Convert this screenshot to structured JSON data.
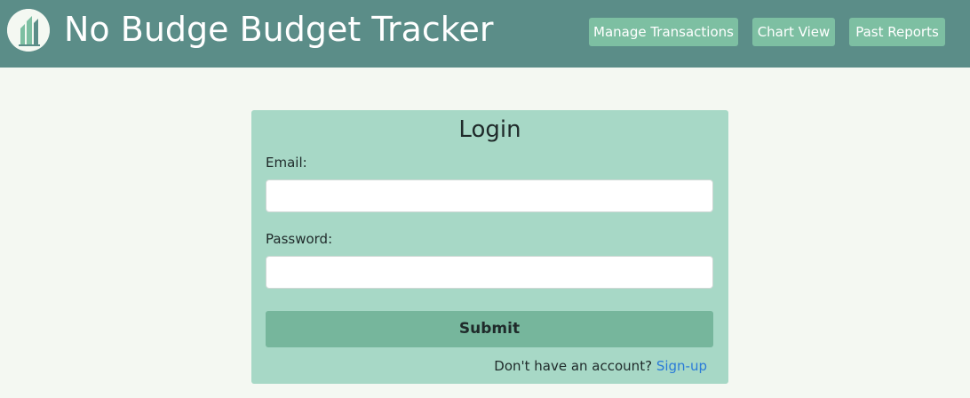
{
  "header": {
    "title": "No Budge Budget Tracker",
    "nav": [
      {
        "label": "Manage Transactions"
      },
      {
        "label": "Chart View"
      },
      {
        "label": "Past Reports"
      }
    ]
  },
  "login": {
    "title": "Login",
    "email_label": "Email:",
    "email_value": "",
    "password_label": "Password:",
    "password_value": "",
    "submit_label": "Submit",
    "signup_prompt": "Don't have an account?",
    "signup_link": "Sign-up"
  },
  "colors": {
    "header_bg": "#5b8d88",
    "nav_button": "#7dbfa2",
    "page_bg": "#f4f8f2",
    "card_bg": "#a7d8c6",
    "submit_bg": "#76b69c",
    "link": "#2a7bd8"
  },
  "icons": {
    "logo": "bar-chart-logo-icon"
  }
}
